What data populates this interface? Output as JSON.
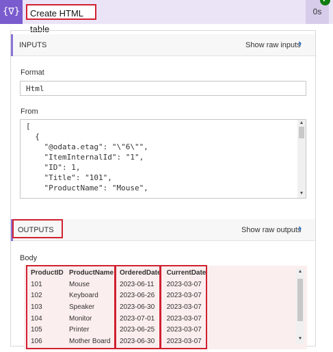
{
  "header": {
    "icon_glyph": "{∇}",
    "action_title": "Create HTML table",
    "duration": "0s",
    "status_icon": "check-icon",
    "accent_color": "#7a5cce"
  },
  "inputs": {
    "section_label": "INPUTS",
    "raw_link": "Show raw inputs",
    "format_label": "Format",
    "format_value": "Html",
    "from_label": "From",
    "from_lines": [
      "[",
      "  {",
      "    \"@odata.etag\": \"\\\"6\\\"\",",
      "    \"ItemInternalId\": \"1\",",
      "    \"ID\": 1,",
      "    \"Title\": \"101\",",
      "    \"ProductName\": \"Mouse\","
    ]
  },
  "outputs": {
    "section_label": "OUTPUTS",
    "raw_link": "Show raw outputs",
    "body_label": "Body",
    "table": {
      "headers": [
        "ProductID",
        "ProductName",
        "OrderedDate",
        "CurrentDate"
      ],
      "rows": [
        [
          "101",
          "Mouse",
          "2023-06-11",
          "2023-03-07"
        ],
        [
          "102",
          "Keyboard",
          "2023-06-26",
          "2023-03-07"
        ],
        [
          "103",
          "Speaker",
          "2023-06-30",
          "2023-03-07"
        ],
        [
          "104",
          "Monitor",
          "2023-07-01",
          "2023-03-07"
        ],
        [
          "105",
          "Printer",
          "2023-06-25",
          "2023-03-07"
        ],
        [
          "106",
          "Mother Board",
          "2023-06-30",
          "2023-03-07"
        ]
      ]
    }
  }
}
